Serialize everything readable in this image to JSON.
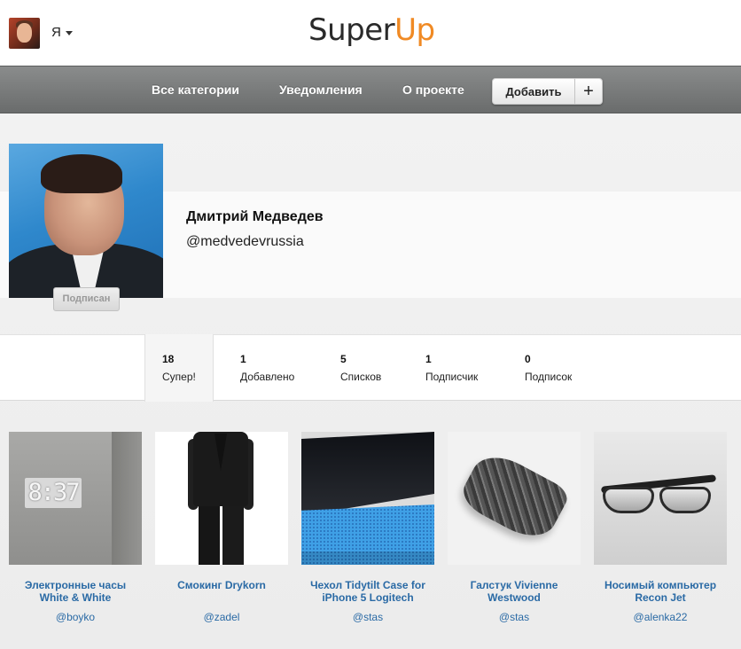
{
  "header": {
    "user_label": "Я",
    "logo_part1": "Super",
    "logo_part2": "Up",
    "logo_accent": "#f08a24"
  },
  "nav": {
    "items": [
      {
        "label": "Все категории"
      },
      {
        "label": "Уведомления"
      },
      {
        "label": "О проекте"
      }
    ],
    "add_label": "Добавить",
    "add_icon": "plus-icon",
    "add_plus": "+"
  },
  "profile": {
    "name": "Дмитрий Медведев",
    "handle": "@medvedevrussia",
    "subscribed_label": "Подписан"
  },
  "stats": [
    {
      "value": "18",
      "label": "Супер!"
    },
    {
      "value": "1",
      "label": "Добавлено"
    },
    {
      "value": "5",
      "label": "Списков"
    },
    {
      "value": "1",
      "label": "Подписчик"
    },
    {
      "value": "0",
      "label": "Подписок"
    }
  ],
  "items": [
    {
      "title": "Электронные часы White & White",
      "author": "@boyko",
      "clock_text": "8:37"
    },
    {
      "title": "Смокинг Drykorn",
      "author": "@zadel"
    },
    {
      "title": "Чехол Tidytilt Case for iPhone 5 Logitech",
      "author": "@stas"
    },
    {
      "title": "Галстук Vivienne Westwood",
      "author": "@stas"
    },
    {
      "title": "Носимый компьютер Recon Jet",
      "author": "@alenka22"
    }
  ],
  "colors": {
    "link": "#2a6aa5",
    "navbar": "#7a7c7c"
  }
}
